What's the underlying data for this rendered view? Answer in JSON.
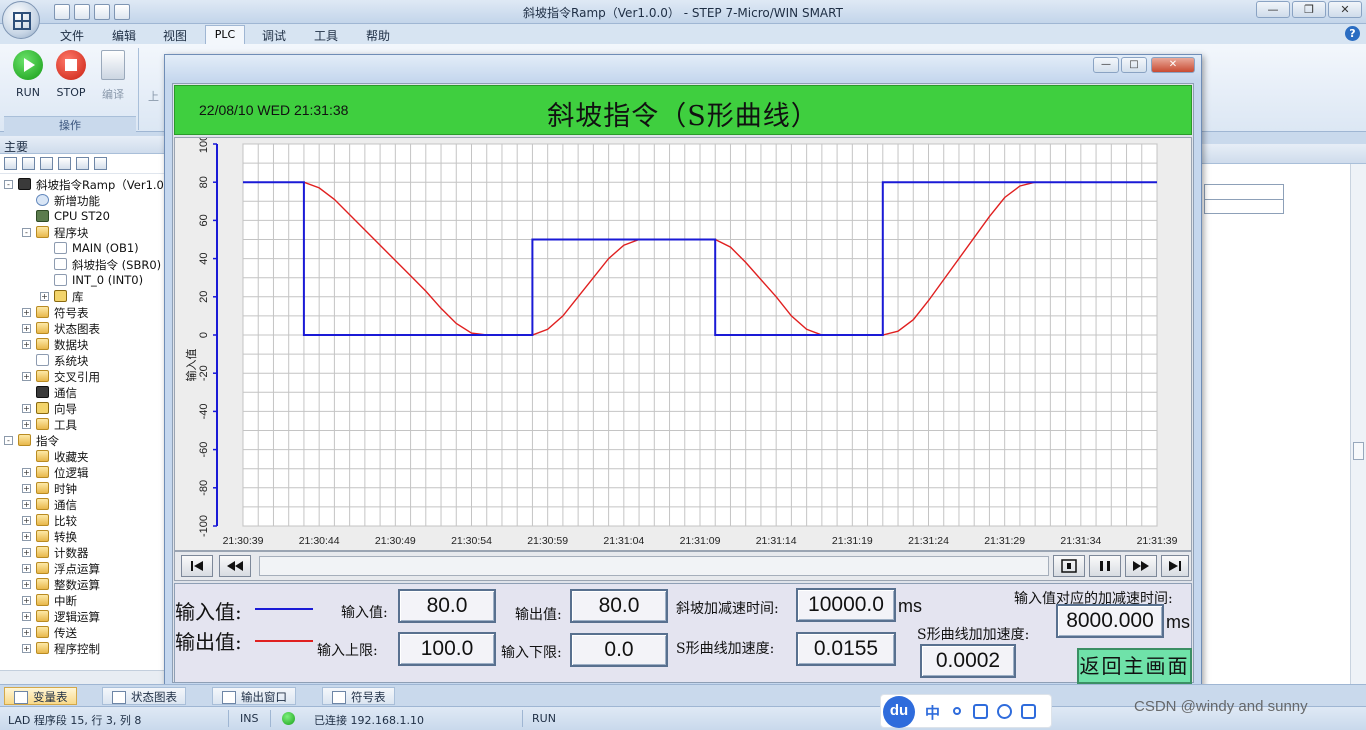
{
  "app": {
    "title": "斜坡指令Ramp（Ver1.0.0） - STEP 7-Micro/WIN SMART",
    "menu": [
      "文件",
      "编辑",
      "视图",
      "PLC",
      "调试",
      "工具",
      "帮助"
    ],
    "ribbon": {
      "run_label": "RUN",
      "stop_label": "STOP",
      "compile_label": "编译",
      "upload_label": "上",
      "group_label": "操作"
    }
  },
  "left_panel": {
    "header": "主要",
    "tree": [
      {
        "label": "斜坡指令Ramp（Ver1.0.",
        "depth": 0,
        "exp": "-",
        "icon": "net"
      },
      {
        "label": "新增功能",
        "depth": 1,
        "exp": "",
        "icon": "help"
      },
      {
        "label": "CPU ST20",
        "depth": 1,
        "exp": "",
        "icon": "cpu"
      },
      {
        "label": "程序块",
        "depth": 1,
        "exp": "-",
        "icon": "folder"
      },
      {
        "label": "MAIN (OB1)",
        "depth": 2,
        "exp": "",
        "icon": "doc"
      },
      {
        "label": "斜坡指令 (SBR0)",
        "depth": 2,
        "exp": "",
        "icon": "doc"
      },
      {
        "label": "INT_0 (INT0)",
        "depth": 2,
        "exp": "",
        "icon": "doc"
      },
      {
        "label": "库",
        "depth": 2,
        "exp": "+",
        "icon": "lib"
      },
      {
        "label": "符号表",
        "depth": 1,
        "exp": "+",
        "icon": "folder"
      },
      {
        "label": "状态图表",
        "depth": 1,
        "exp": "+",
        "icon": "folder"
      },
      {
        "label": "数据块",
        "depth": 1,
        "exp": "+",
        "icon": "folder"
      },
      {
        "label": "系统块",
        "depth": 1,
        "exp": "",
        "icon": "doc"
      },
      {
        "label": "交叉引用",
        "depth": 1,
        "exp": "+",
        "icon": "folder"
      },
      {
        "label": "通信",
        "depth": 1,
        "exp": "",
        "icon": "net"
      },
      {
        "label": "向导",
        "depth": 1,
        "exp": "+",
        "icon": "lib"
      },
      {
        "label": "工具",
        "depth": 1,
        "exp": "+",
        "icon": "folder"
      },
      {
        "label": "指令",
        "depth": 0,
        "exp": "-",
        "icon": "folder"
      },
      {
        "label": "收藏夹",
        "depth": 1,
        "exp": "",
        "icon": "folder"
      },
      {
        "label": "位逻辑",
        "depth": 1,
        "exp": "+",
        "icon": "folder"
      },
      {
        "label": "时钟",
        "depth": 1,
        "exp": "+",
        "icon": "folder"
      },
      {
        "label": "通信",
        "depth": 1,
        "exp": "+",
        "icon": "folder"
      },
      {
        "label": "比较",
        "depth": 1,
        "exp": "+",
        "icon": "folder"
      },
      {
        "label": "转换",
        "depth": 1,
        "exp": "+",
        "icon": "folder"
      },
      {
        "label": "计数器",
        "depth": 1,
        "exp": "+",
        "icon": "folder"
      },
      {
        "label": "浮点运算",
        "depth": 1,
        "exp": "+",
        "icon": "folder"
      },
      {
        "label": "整数运算",
        "depth": 1,
        "exp": "+",
        "icon": "folder"
      },
      {
        "label": "中断",
        "depth": 1,
        "exp": "+",
        "icon": "folder"
      },
      {
        "label": "逻辑运算",
        "depth": 1,
        "exp": "+",
        "icon": "folder"
      },
      {
        "label": "传送",
        "depth": 1,
        "exp": "+",
        "icon": "folder"
      },
      {
        "label": "程序控制",
        "depth": 1,
        "exp": "+",
        "icon": "folder"
      }
    ]
  },
  "bottom_tabs": [
    "变量表",
    "状态图表",
    "输出窗口",
    "符号表"
  ],
  "status_bar": {
    "mode": "LAD 程序段 15, 行 3, 列 8",
    "ins": "INS",
    "connection": "已连接 192.168.1.10",
    "plc_state": "RUN"
  },
  "ime": {
    "logo": "du",
    "lang": "中"
  },
  "watermark": "CSDN @windy and sunny",
  "hmi": {
    "datetime": "22/08/10 WED 21:31:38",
    "title": "斜坡指令（S形曲线）",
    "legend_input": "输入值:",
    "legend_output": "输出值:",
    "labels": {
      "input_value": "输入值:",
      "output_value": "输出值:",
      "ramp_time": "斜坡加减速时间:",
      "input_upper": "输入上限:",
      "input_lower": "输入下限:",
      "s_accel": "S形曲线加速度:",
      "s_add_accel": "S形曲线加加速度:",
      "accel_time_for_input": "输入值对应的加减速时间:"
    },
    "values": {
      "input_value": "80.0",
      "output_value": "80.0",
      "ramp_time": "10000.0",
      "input_upper": "100.0",
      "input_lower": "0.0",
      "s_accel": "0.0155",
      "s_add_accel": "0.0002",
      "accel_time_for_input": "8000.000"
    },
    "units": {
      "ramp_time": "ms",
      "accel_time_for_input": "ms"
    },
    "return_button": "返回主画面"
  },
  "chart_data": {
    "type": "line",
    "ylabel": "输入值",
    "ylim": [
      -100,
      100
    ],
    "yticks": [
      -100,
      -80,
      -60,
      -40,
      -20,
      0,
      20,
      40,
      60,
      80,
      100
    ],
    "xlim": [
      "21:30:39",
      "21:31:39"
    ],
    "xticks": [
      "21:30:39",
      "21:30:44",
      "21:30:49",
      "21:30:54",
      "21:30:59",
      "21:31:04",
      "21:31:09",
      "21:31:14",
      "21:31:19",
      "21:31:24",
      "21:31:29",
      "21:31:34",
      "21:31:39"
    ],
    "grid": true,
    "colors": {
      "input": "#1a1ad6",
      "output": "#e02020"
    },
    "series": [
      {
        "key": "input",
        "points": [
          [
            "21:30:39",
            80
          ],
          [
            "21:30:43",
            80
          ],
          [
            "21:30:43",
            0
          ],
          [
            "21:30:58",
            0
          ],
          [
            "21:30:58",
            50
          ],
          [
            "21:31:10",
            50
          ],
          [
            "21:31:10",
            0
          ],
          [
            "21:31:21",
            0
          ],
          [
            "21:31:21",
            80
          ],
          [
            "21:31:39",
            80
          ]
        ]
      },
      {
        "key": "output",
        "points": [
          [
            "21:30:39",
            80
          ],
          [
            "21:30:43",
            80
          ],
          [
            "21:30:44",
            77
          ],
          [
            "21:30:45",
            71
          ],
          [
            "21:30:50",
            31
          ],
          [
            "21:30:51",
            23
          ],
          [
            "21:30:52",
            14
          ],
          [
            "21:30:53",
            6
          ],
          [
            "21:30:54",
            1
          ],
          [
            "21:30:55",
            0
          ],
          [
            "21:30:58",
            0
          ],
          [
            "21:30:59",
            3
          ],
          [
            "21:31:00",
            10
          ],
          [
            "21:31:01",
            20
          ],
          [
            "21:31:03",
            40
          ],
          [
            "21:31:04",
            47
          ],
          [
            "21:31:05",
            50
          ],
          [
            "21:31:10",
            50
          ],
          [
            "21:31:11",
            46
          ],
          [
            "21:31:12",
            38
          ],
          [
            "21:31:14",
            20
          ],
          [
            "21:31:15",
            10
          ],
          [
            "21:31:16",
            3
          ],
          [
            "21:31:17",
            0
          ],
          [
            "21:31:21",
            0
          ],
          [
            "21:31:22",
            2
          ],
          [
            "21:31:23",
            8
          ],
          [
            "21:31:24",
            18
          ],
          [
            "21:31:28",
            62
          ],
          [
            "21:31:29",
            72
          ],
          [
            "21:31:30",
            78
          ],
          [
            "21:31:31",
            80
          ],
          [
            "21:31:39",
            80
          ]
        ]
      }
    ]
  }
}
